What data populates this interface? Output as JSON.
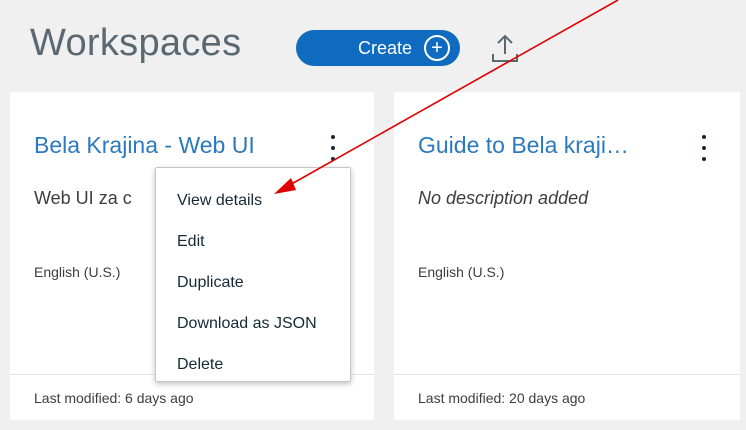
{
  "header": {
    "title": "Workspaces",
    "create_label": "Create",
    "create_icon": "plus-circle-icon",
    "upload_icon": "upload-icon"
  },
  "cards": [
    {
      "title": "Bela Krajina - Web UI",
      "description": "Web UI za c",
      "language": "English (U.S.)",
      "last_modified": "Last modified: 6 days ago"
    },
    {
      "title": "Guide to Bela kraji…",
      "description": "No description added",
      "language": "English (U.S.)",
      "last_modified": "Last modified: 20 days ago"
    }
  ],
  "menu": {
    "items": [
      "View details",
      "Edit",
      "Duplicate",
      "Download as JSON",
      "Delete"
    ]
  },
  "colors": {
    "accent": "#0f6bbf",
    "link": "#2c79bf",
    "annotation_arrow": "#e00000",
    "background": "#f0f0f0"
  }
}
